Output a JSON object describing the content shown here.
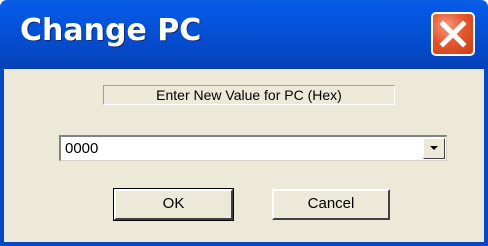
{
  "window": {
    "title": "Change PC"
  },
  "prompt": {
    "text": "Enter New Value for PC (Hex)"
  },
  "pc_input": {
    "value": "0000"
  },
  "buttons": {
    "ok_label": "OK",
    "cancel_label": "Cancel"
  },
  "icons": {
    "close": "close-icon",
    "dropdown": "chevron-down-icon"
  },
  "colors": {
    "titlebar": "#0552d8",
    "close_button": "#e5582f",
    "dialog_face": "#ece9d8"
  }
}
